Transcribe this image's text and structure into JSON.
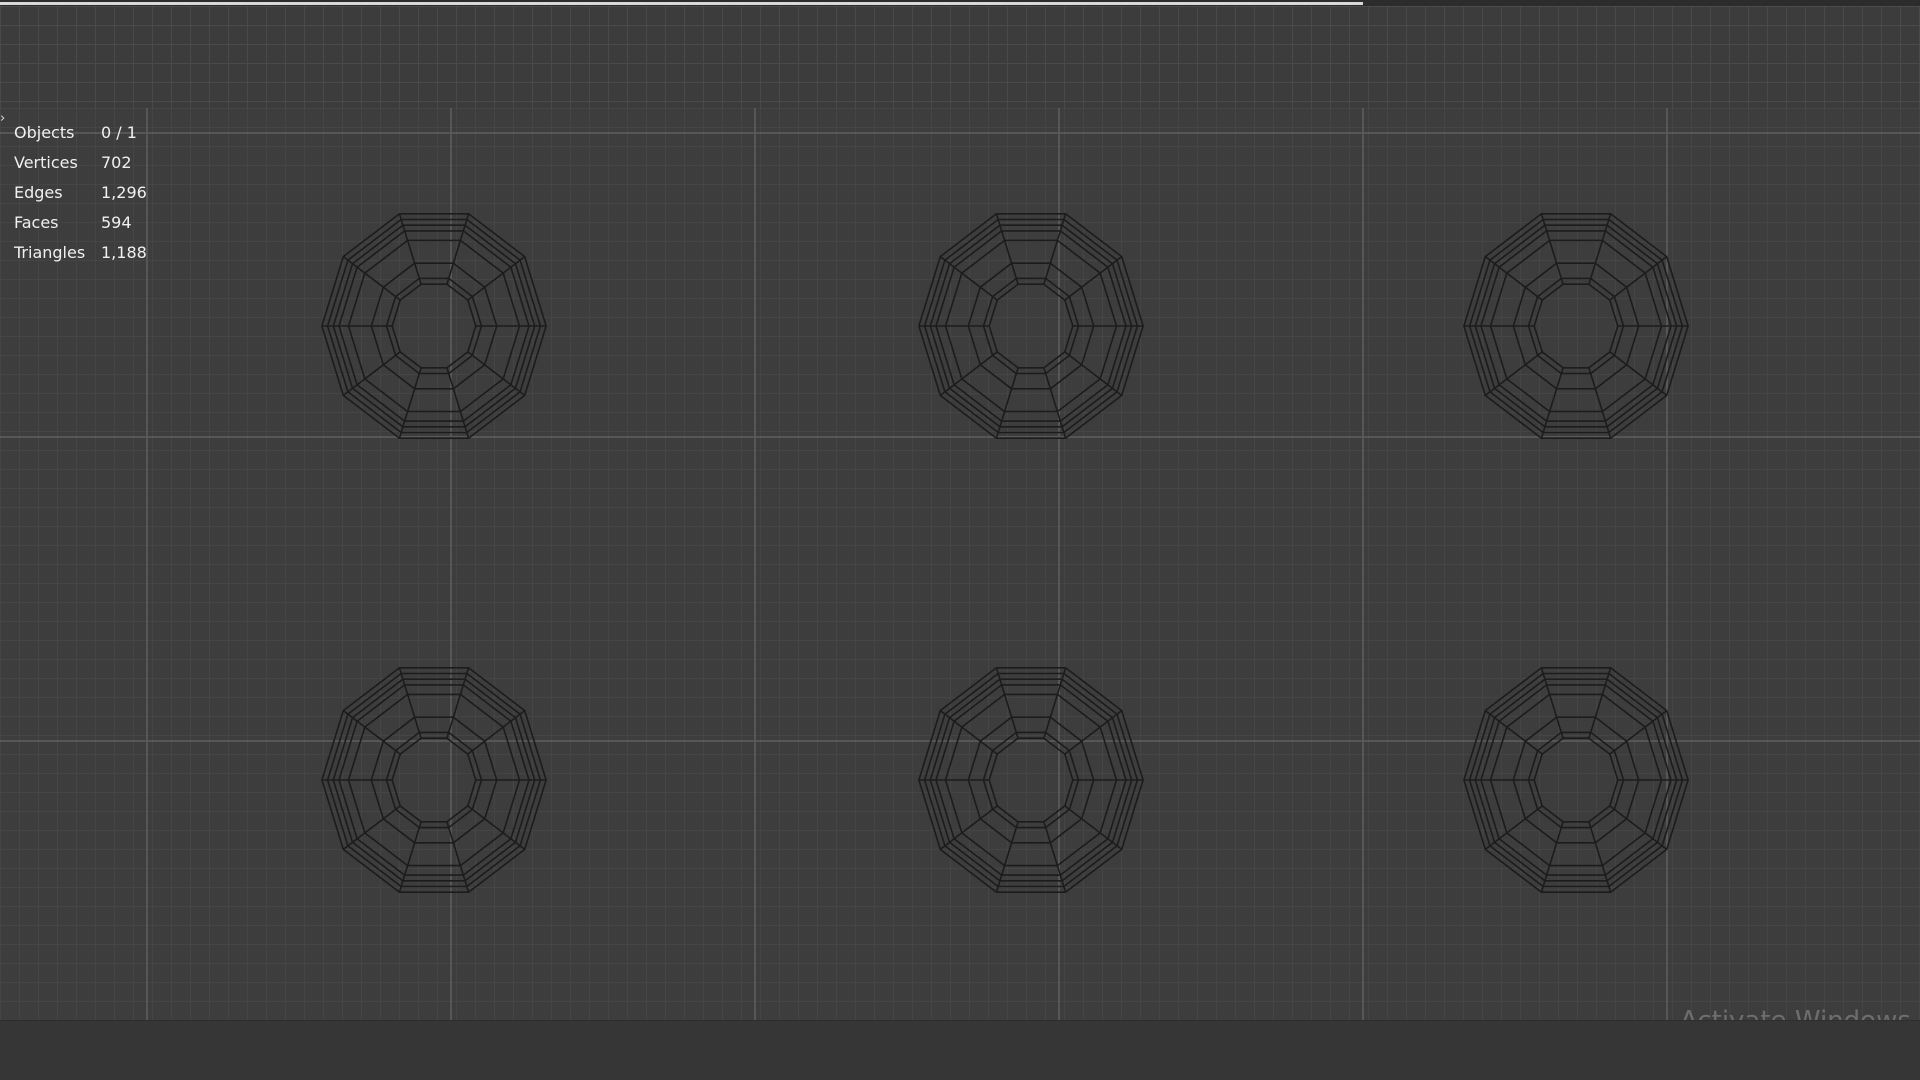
{
  "stats": {
    "rows": [
      {
        "label": "Objects",
        "value": "0 / 1"
      },
      {
        "label": "Vertices",
        "value": "702"
      },
      {
        "label": "Edges",
        "value": "1,296"
      },
      {
        "label": "Faces",
        "value": "594"
      },
      {
        "label": "Triangles",
        "value": "1,188"
      }
    ]
  },
  "overlay": {
    "corner_icon": "chevron-right-icon",
    "watermark": "Activate Windows"
  },
  "viewport": {
    "mesh_count": 6,
    "wire_color": "#1c1c1c"
  },
  "top_progress": {
    "fraction": 0.71
  }
}
